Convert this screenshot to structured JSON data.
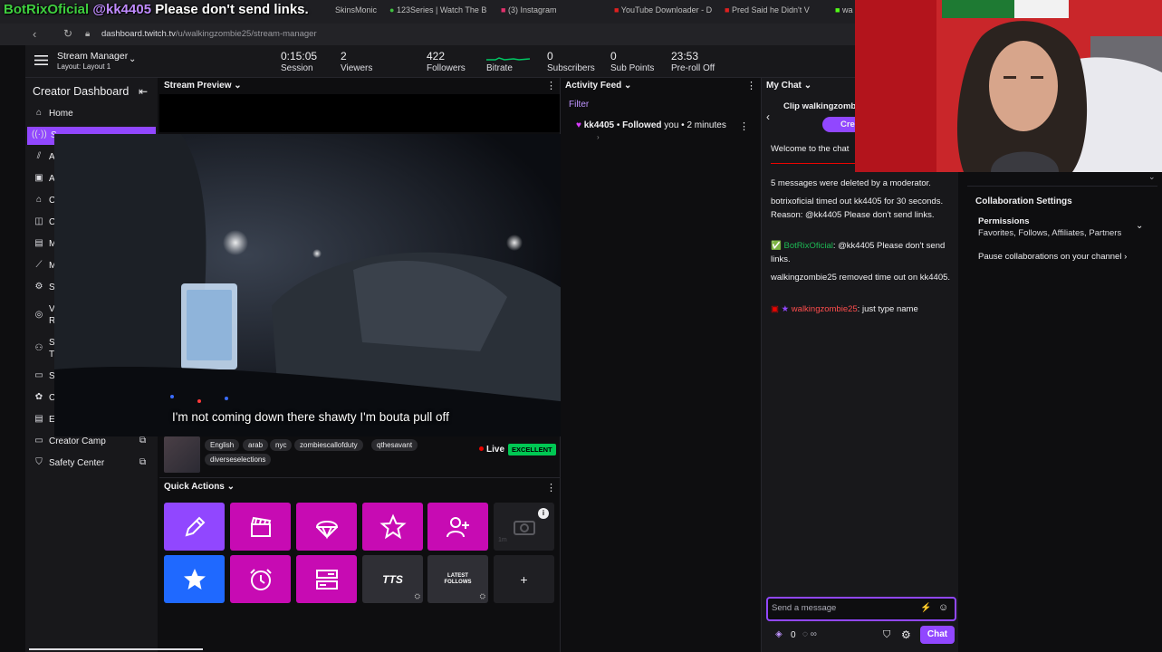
{
  "overlay": {
    "user1": "BotRixOficial",
    "user2": "@kk4405",
    "text": "Please don't send links."
  },
  "browser": {
    "tabs": [
      {
        "label": "SkinsMonic",
        "icon": "skins-tab-icon"
      },
      {
        "label": "123Series | Watch The B",
        "icon": "series-tab-icon"
      },
      {
        "label": "(3) Instagram",
        "icon": "instagram-tab-icon"
      },
      {
        "label": "YouTube Downloader - D",
        "icon": "youtube-tab-icon"
      },
      {
        "label": "Pred Said he Didn't V",
        "icon": "youtube-tab-icon"
      },
      {
        "label": "wa",
        "icon": "kick-tab-icon"
      }
    ],
    "url_host": "dashboard.twitch.tv",
    "url_path": "/u/walkingzombie25/stream-manager"
  },
  "topbar": {
    "title": "Stream Manager",
    "layout": "Layout: Layout 1",
    "stats": [
      {
        "value": "0:15:05",
        "label": "Session"
      },
      {
        "value": "2",
        "label": "Viewers"
      },
      {
        "value": "422",
        "label": "Followers"
      },
      {
        "value": "",
        "label": "Bitrate"
      },
      {
        "value": "0",
        "label": "Subscribers"
      },
      {
        "value": "0",
        "label": "Sub Points"
      },
      {
        "value": "23:53",
        "label": "Pre-roll Off"
      }
    ]
  },
  "sidebar": {
    "title": "Creator Dashboard",
    "items": [
      {
        "label": "Home",
        "icon": "home-icon"
      },
      {
        "label": "S",
        "icon": "broadcast-icon"
      },
      {
        "label": "A",
        "icon": "analytics-icon"
      },
      {
        "label": "A",
        "icon": "achievements-icon"
      },
      {
        "label": "C",
        "icon": "community-icon"
      },
      {
        "label": "C",
        "icon": "content-icon"
      },
      {
        "label": "M",
        "icon": "monetization-icon"
      },
      {
        "label": "M",
        "icon": "moderation-icon"
      },
      {
        "label": "S",
        "icon": "settings-icon"
      },
      {
        "label": "V",
        "sub": "R",
        "icon": "viewer-rewards-icon"
      },
      {
        "label": "S",
        "sub": "T",
        "icon": "stream-together-icon"
      },
      {
        "label": "S",
        "icon": "video-icon"
      },
      {
        "label": "C",
        "icon": "extensions-icon"
      },
      {
        "label": "E",
        "icon": "events-icon"
      },
      {
        "label": "Creator Camp",
        "icon": "creator-camp-icon"
      },
      {
        "label": "Safety Center",
        "icon": "safety-center-icon"
      }
    ]
  },
  "preview": {
    "header": "Stream Preview",
    "subtitle": "I'm not coming down there shawty I'm bouta pull off",
    "tags": [
      "English",
      "arab",
      "nyc",
      "zombiescallofduty",
      "qthesavant",
      "diverseselections"
    ],
    "live": "Live",
    "quality": "EXCELLENT"
  },
  "quick_actions": {
    "header": "Quick Actions",
    "row1": [
      {
        "icon": "pencil-icon",
        "color": "#9147ff"
      },
      {
        "icon": "clapperboard-icon",
        "color": "#c70bb3"
      },
      {
        "icon": "parachute-icon",
        "color": "#c70bb3"
      },
      {
        "icon": "star-outline-icon",
        "color": "#c70bb3"
      },
      {
        "icon": "add-user-icon",
        "color": "#c70bb3"
      },
      {
        "icon": "camera-disabled-icon",
        "color": "#1f1f23",
        "note": "1m"
      }
    ],
    "row2": [
      {
        "icon": "star-filled-icon",
        "color": "#1f69ff"
      },
      {
        "icon": "reward-timer-icon",
        "color": "#c70bb3"
      },
      {
        "icon": "layout-icon",
        "color": "#c70bb3"
      },
      {
        "icon": "tts-icon",
        "label": "TTS",
        "color": "#2f2f35"
      },
      {
        "icon": "latest-follows-icon",
        "label": "LATEST FOLLOWS",
        "color": "#2f2f35"
      },
      {
        "icon": "plus-icon",
        "label": "+",
        "color": "#1f1f23"
      }
    ]
  },
  "activity_feed": {
    "header": "Activity Feed",
    "filter": "Filter",
    "items": [
      {
        "user": "kk4405",
        "action": "Followed",
        "rest": "you • 2 minutes"
      }
    ]
  },
  "chat": {
    "header": "My Chat",
    "clip_title": "Clip walkingzomb",
    "clip_button": "Cre",
    "welcome": "Welcome to the chat",
    "messages": [
      {
        "text": "5 messages were deleted by a moderator."
      },
      {
        "text": "botrixoficial timed out kk4405 for 30 seconds. Reason: @kk4405 Please don't send links."
      },
      {
        "user": "BotRixOficial",
        "user_color": "#1db954",
        "text": "@kk4405 Please don't send links."
      },
      {
        "text": "walkingzombie25 removed time out on kk4405."
      },
      {
        "user": "walkingzombie25",
        "user_color": "#ff4d4d",
        "text": "just type name"
      }
    ],
    "input_placeholder": "Send a message",
    "points": "0",
    "chat_button": "Chat"
  },
  "collab": {
    "title": "Collaboration Settings",
    "permissions_label": "Permissions",
    "permissions_value": "Favorites, Follows, Affiliates, Partners",
    "pause_label": "Pause collaborations on your channel"
  }
}
